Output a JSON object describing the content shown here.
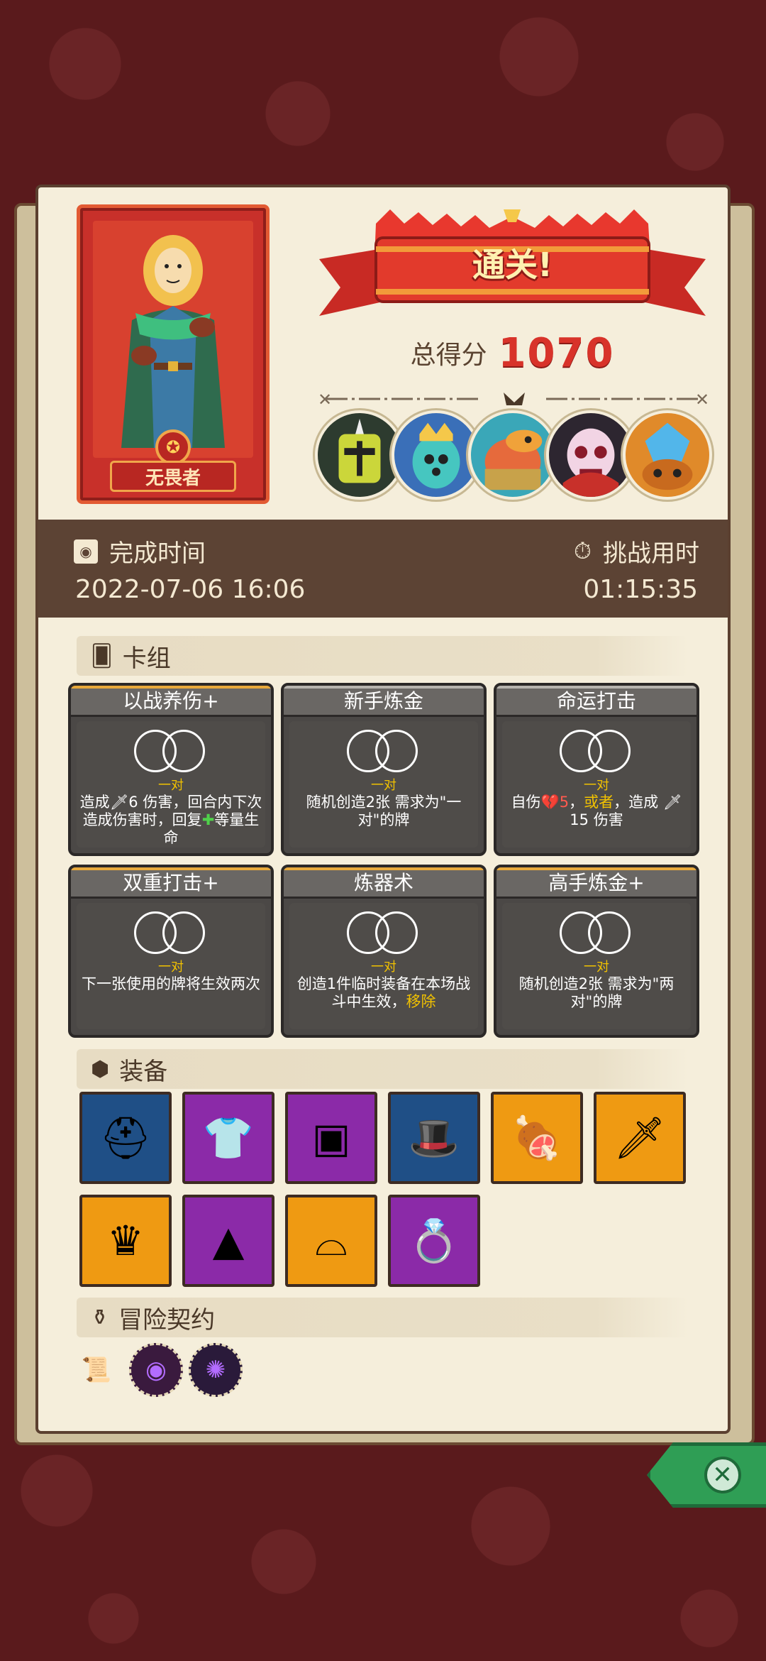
{
  "hero": {
    "name": "无畏者",
    "emblem": "star-emblem"
  },
  "result": {
    "title": "通关!",
    "score_label": "总得分",
    "score_value": "1070"
  },
  "bosses": [
    {
      "name": "green-armored-knight",
      "bg": "#2d3b2f"
    },
    {
      "name": "crowned-alien",
      "bg": "#3a6fb8"
    },
    {
      "name": "lizard-warrior",
      "bg": "#3aa7b8"
    },
    {
      "name": "vampire-skull",
      "bg": "#2d2630"
    },
    {
      "name": "crystal-golem",
      "bg": "#e08a2a"
    }
  ],
  "timebar": {
    "finish_label": "完成时间",
    "finish_value": "2022-07-06 16:06",
    "duration_label": "挑战用时",
    "duration_value": "01:15:35"
  },
  "sections": {
    "deck": "卡组",
    "equipment": "装备",
    "contracts": "冒险契约"
  },
  "cards": [
    {
      "title": "以战养伤+",
      "pair": "一对",
      "variant": "gold",
      "desc_parts": [
        "造成",
        "🗡6 伤害，回合内下次造成伤害时，回复",
        "✚",
        "等量生命"
      ]
    },
    {
      "title": "新手炼金",
      "pair": "一对",
      "variant": "gray",
      "desc_parts": [
        "随机创造2张 需求为\"一对\"的牌"
      ]
    },
    {
      "title": "命运打击",
      "pair": "一对",
      "variant": "gray",
      "desc_parts": [
        "自伤",
        "💔5",
        "，",
        "或者",
        "，造成 🗡15 伤害"
      ]
    },
    {
      "title": "双重打击+",
      "pair": "一对",
      "variant": "gold",
      "desc_parts": [
        "下一张使用的牌将生效两次"
      ]
    },
    {
      "title": "炼器术",
      "pair": "一对",
      "variant": "gold",
      "desc_parts": [
        "创造1件临时装备在本场战斗中生效，",
        "移除"
      ]
    },
    {
      "title": "高手炼金+",
      "pair": "一对",
      "variant": "gold",
      "desc_parts": [
        "随机创造2张 需求为\"两对\"的牌"
      ]
    }
  ],
  "equipment": [
    {
      "name": "golden-helmet",
      "glyph": "⛑",
      "color": "blue"
    },
    {
      "name": "blue-tunic",
      "glyph": "👕",
      "color": "purple"
    },
    {
      "name": "metal-cube",
      "glyph": "▣",
      "color": "purple"
    },
    {
      "name": "magic-hat-dice",
      "glyph": "🎩",
      "color": "blue"
    },
    {
      "name": "ham-meat",
      "glyph": "🍖",
      "color": "orange"
    },
    {
      "name": "blue-serrated-blade",
      "glyph": "🗡",
      "color": "orange"
    },
    {
      "name": "golden-crown",
      "glyph": "♛",
      "color": "orange"
    },
    {
      "name": "cheese-wedge",
      "glyph": "▲",
      "color": "purple"
    },
    {
      "name": "red-hood",
      "glyph": "⌓",
      "color": "orange"
    },
    {
      "name": "gem-ring",
      "glyph": "💍",
      "color": "purple"
    }
  ],
  "contracts": [
    {
      "name": "scroll-contract",
      "glyph": "📜"
    },
    {
      "name": "purple-eye-contract",
      "glyph": "◉"
    },
    {
      "name": "dark-vortex-contract",
      "glyph": "✺"
    }
  ],
  "colors": {
    "accent_red": "#d8332a",
    "timebar_bg": "#5c4334",
    "close_green": "#2f9e55"
  }
}
